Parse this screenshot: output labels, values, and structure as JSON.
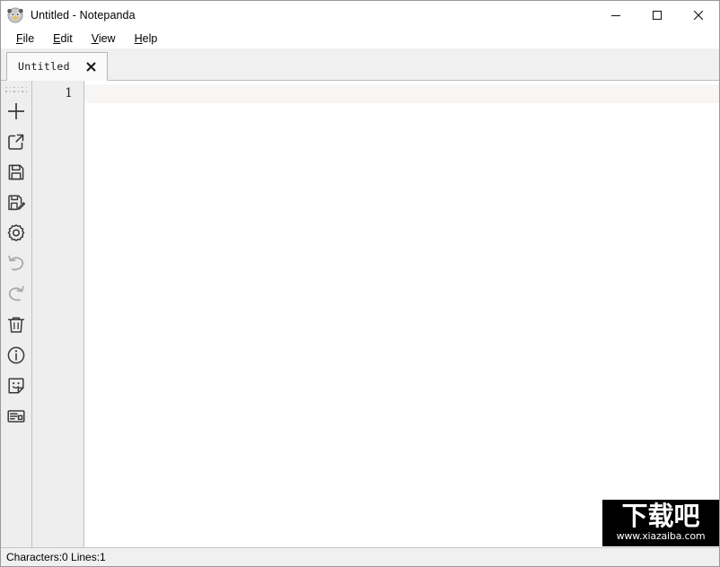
{
  "window": {
    "title": "Untitled - Notepanda",
    "app_icon": "panda-logo-icon",
    "controls": {
      "minimize_label": "Minimize",
      "maximize_label": "Maximize",
      "close_label": "Close"
    }
  },
  "menubar": {
    "items": [
      {
        "label": "File",
        "mnemonic": "F",
        "rest": "ile"
      },
      {
        "label": "Edit",
        "mnemonic": "E",
        "rest": "dit"
      },
      {
        "label": "View",
        "mnemonic": "V",
        "rest": "iew"
      },
      {
        "label": "Help",
        "mnemonic": "H",
        "rest": "elp"
      }
    ]
  },
  "tabs": [
    {
      "label": "Untitled",
      "close_label": "✕",
      "active": true
    }
  ],
  "toolbar": {
    "grip_label": "toolbar-drag-handle",
    "buttons": [
      {
        "name": "new-file-button",
        "icon": "plus-icon",
        "tooltip": "New"
      },
      {
        "name": "open-file-button",
        "icon": "open-external-icon",
        "tooltip": "Open"
      },
      {
        "name": "save-file-button",
        "icon": "floppy-disk-icon",
        "tooltip": "Save"
      },
      {
        "name": "save-as-button",
        "icon": "floppy-disk-pencil-icon",
        "tooltip": "Save As"
      },
      {
        "name": "settings-button",
        "icon": "gear-icon",
        "tooltip": "Settings"
      },
      {
        "name": "undo-button",
        "icon": "undo-arrow-icon",
        "tooltip": "Undo"
      },
      {
        "name": "redo-button",
        "icon": "redo-arrow-icon",
        "tooltip": "Redo"
      },
      {
        "name": "delete-button",
        "icon": "trash-can-icon",
        "tooltip": "Delete"
      },
      {
        "name": "about-button",
        "icon": "info-circle-icon",
        "tooltip": "About"
      },
      {
        "name": "sticker-button",
        "icon": "sticky-note-smiley-icon",
        "tooltip": "Sticker"
      },
      {
        "name": "layout-button",
        "icon": "panel-layout-icon",
        "tooltip": "Layout"
      }
    ]
  },
  "editor": {
    "line_numbers": [
      "1"
    ],
    "content": "",
    "current_line": 1
  },
  "statusbar": {
    "text": "Characters:0 Lines:1",
    "characters": 0,
    "lines": 1
  },
  "watermark": {
    "logo": "下载吧",
    "url": "www.xiazaiba.com"
  },
  "colors": {
    "titlebar_bg": "#ffffff",
    "tabbar_bg": "#f0f0f0",
    "toolbar_bg": "#eeeeee",
    "gutter_bg": "#eeeeee",
    "editor_bg": "#ffffff",
    "current_line_bg": "#f7f6f4",
    "statusbar_bg": "#f0f0f0",
    "border": "#c0c0c0",
    "icon_stroke": "#3a3a3a",
    "watermark_bg": "#000000"
  }
}
